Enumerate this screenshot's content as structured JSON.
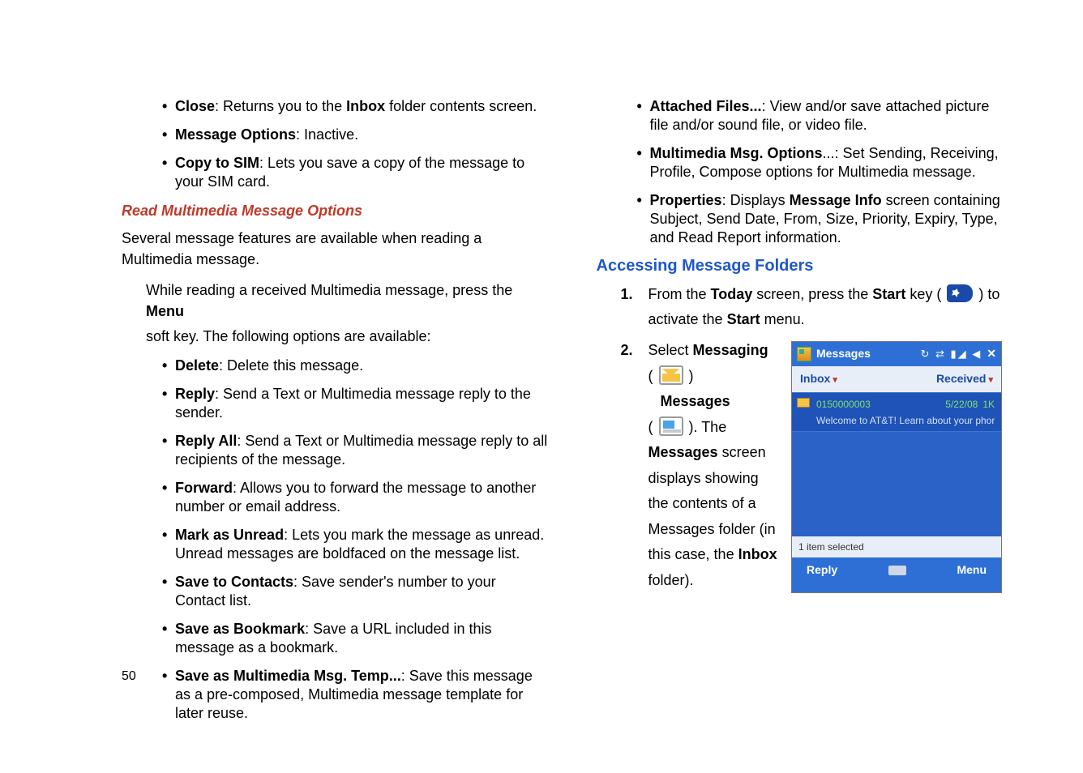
{
  "left": {
    "top_bullets": [
      {
        "term": "Close",
        "desc": ": Returns you to the ",
        "bold_inline": "Inbox",
        "desc_after": " folder contents screen."
      },
      {
        "term": "Message Options",
        "desc": ": Inactive."
      },
      {
        "term": "Copy to SIM",
        "desc": ": Lets you save a copy of the message to your SIM card."
      }
    ],
    "red_head": "Read Multimedia Message Options",
    "para1": "Several message features are available when reading a Multimedia message.",
    "para2a": "While reading a received Multimedia message, press the ",
    "para2b": "Menu",
    "para3": "soft key. The following options are available:",
    "main_bullets": [
      {
        "term": "Delete",
        "desc": ": Delete this message."
      },
      {
        "term": "Reply",
        "desc": ": Send a Text or Multimedia message reply to the sender."
      },
      {
        "term": "Reply All",
        "desc": ": Send a Text or Multimedia message reply to all recipients of the message."
      },
      {
        "term": "Forward",
        "desc": ": Allows you to forward the message to another number or email address."
      },
      {
        "term": "Mark as Unread",
        "desc": ": Lets you mark the message as unread. Unread messages are boldfaced on the message list."
      },
      {
        "term": "Save to Contacts",
        "desc": ": Save sender's number to your Contact list."
      },
      {
        "term": "Save as Bookmark",
        "desc": ": Save a URL included in this message as a bookmark."
      },
      {
        "term": "Save as Multimedia Msg. Temp...",
        "desc": ": Save this message as a pre-composed, Multimedia message template for later reuse."
      }
    ]
  },
  "right": {
    "top_bullets": [
      {
        "term": "Attached Files...",
        "desc": ": View and/or save attached picture file and/or sound file, or video file."
      },
      {
        "term": "Multimedia Msg. Options",
        "desc": "...: Set Sending, Receiving, Profile, Compose options for Multimedia message."
      },
      {
        "term": "Properties",
        "desc_pre": ": Displays ",
        "bold_inline": "Message Info",
        "desc_after": " screen containing Subject, Send Date, From, Size, Priority, Expiry, Type, and Read Report information."
      }
    ],
    "blue_head": "Accessing Message Folders",
    "step1_a": "From the ",
    "step1_b": "Today",
    "step1_c": " screen, press the ",
    "step1_d": "Start",
    "step1_e": " key ( ",
    "step1_f": " ) to activate the ",
    "step1_g": "Start",
    "step1_h": " menu.",
    "step2_label": "Select ",
    "step2_bold1": "Messaging",
    "step2_line2_a": "( ",
    "step2_line2_b": " ) ",
    "step2_bold2": "Messages",
    "step2_line3_a": "( ",
    "step2_line3_b": " ). The ",
    "step2_bold3": "Messages",
    "step2_line4": " screen displays showing the contents of a Messages folder (in this case, the ",
    "step2_bold4": "Inbox",
    "step2_line5": " folder)."
  },
  "phone": {
    "title": "Messages",
    "status_icons": "↻ ⇄ ▮◢ ◀",
    "close": "✕",
    "left_dd": "Inbox",
    "right_dd": "Received",
    "row_sender": "0150000003",
    "row_date": "5/22/08",
    "row_size": "1K",
    "row_preview": "Welcome to AT&T! Learn about your phon...",
    "status_bar": "1 item selected",
    "soft_left": "Reply",
    "soft_right": "Menu"
  },
  "page_number": "50"
}
